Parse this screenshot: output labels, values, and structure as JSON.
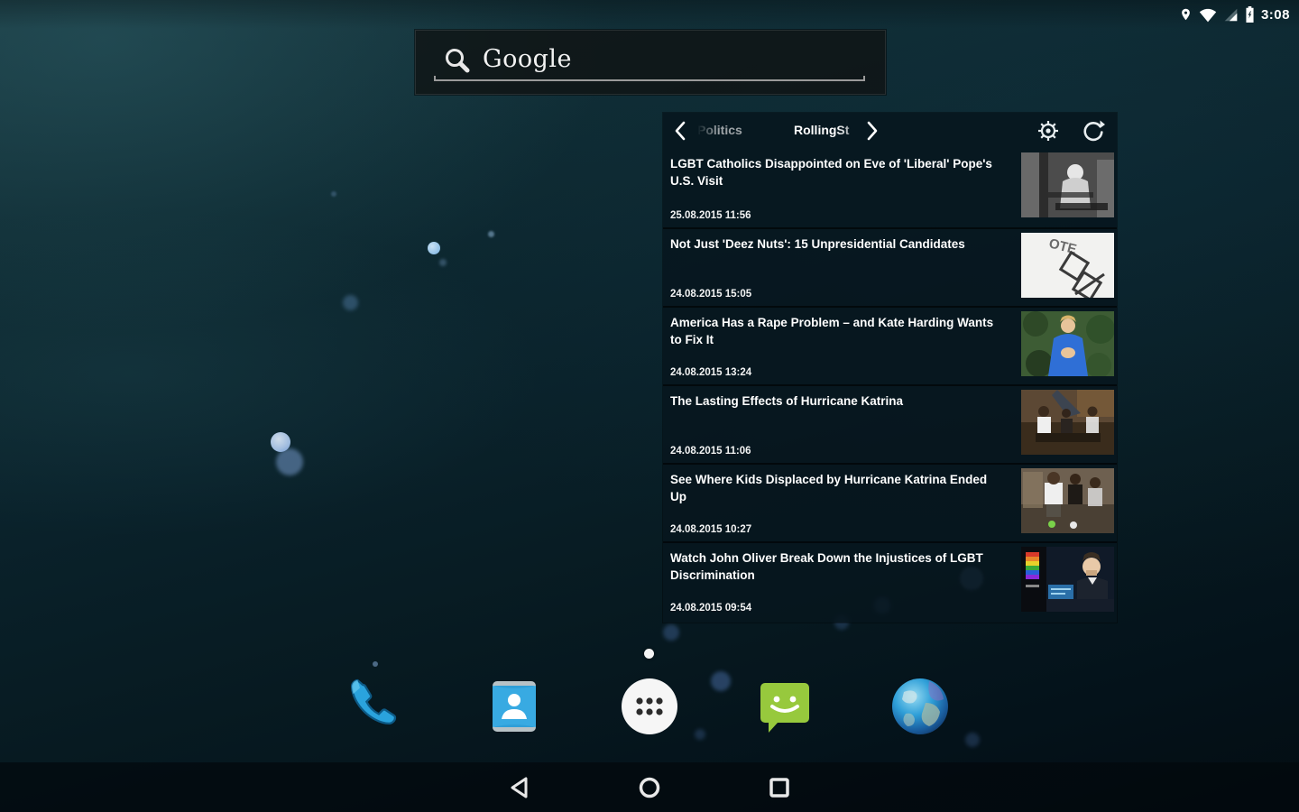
{
  "status_bar": {
    "time": "3:08",
    "icons": [
      "location-icon",
      "wifi-icon",
      "cell-signal-icon",
      "battery-icon"
    ]
  },
  "search_widget": {
    "logo_text": "Google",
    "icon": "search-icon"
  },
  "news_widget": {
    "tabs": [
      {
        "label": "Politics"
      },
      {
        "label": "RollingSt"
      }
    ],
    "controls": {
      "prev": "chevron-left-icon",
      "next": "chevron-right-icon",
      "settings": "gear-icon",
      "refresh": "refresh-icon"
    },
    "articles": [
      {
        "title": "LGBT Catholics Disappointed on Eve of 'Liberal' Pope's U.S. Visit",
        "date": "25.08.2015 11:56",
        "thumbnail": "pope-black-white-photo"
      },
      {
        "title": "Not Just 'Deez Nuts': 15 Unpresidential Candidates",
        "date": "24.08.2015 15:05",
        "thumbnail": "vote-ballot-checkbox"
      },
      {
        "title": "America Has a Rape Problem – and Kate Harding Wants to Fix It",
        "date": "24.08.2015 13:24",
        "thumbnail": "woman-blue-dress-photo"
      },
      {
        "title": "The Lasting Effects of Hurricane Katrina",
        "date": "24.08.2015 11:06",
        "thumbnail": "katrina-group-photo"
      },
      {
        "title": "See Where Kids Displaced by Hurricane Katrina Ended Up",
        "date": "24.08.2015 10:27",
        "thumbnail": "kids-group-photo"
      },
      {
        "title": "Watch John Oliver Break Down the Injustices of LGBT Discrimination",
        "date": "24.08.2015 09:54",
        "thumbnail": "john-oliver-show-still"
      }
    ]
  },
  "dock": {
    "apps": [
      {
        "name": "phone"
      },
      {
        "name": "contacts"
      },
      {
        "name": "app-drawer"
      },
      {
        "name": "messaging"
      },
      {
        "name": "browser"
      }
    ]
  },
  "nav_bar": {
    "buttons": [
      {
        "name": "back"
      },
      {
        "name": "home"
      },
      {
        "name": "recents"
      }
    ]
  },
  "colors": {
    "widget_bg": "#07161e",
    "accent_blue": "#2aa3dd",
    "messaging_green": "#97c93d",
    "wallpaper_teal": "#0e2a32"
  }
}
